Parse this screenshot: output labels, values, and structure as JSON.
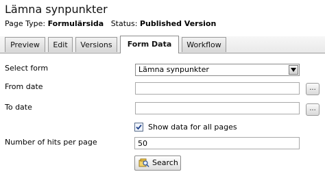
{
  "header": {
    "title": "Lämna synpunkter",
    "page_type_label": "Page Type:",
    "page_type_value": "Formulärsida",
    "status_label": "Status:",
    "status_value": "Published Version"
  },
  "tabs": [
    {
      "label": "Preview",
      "active": false
    },
    {
      "label": "Edit",
      "active": false
    },
    {
      "label": "Versions",
      "active": false
    },
    {
      "label": "Form Data",
      "active": true
    },
    {
      "label": "Workflow",
      "active": false
    }
  ],
  "form": {
    "select_form_label": "Select form",
    "select_form_value": "Lämna synpunkter",
    "from_date_label": "From date",
    "from_date_value": "",
    "to_date_label": "To date",
    "to_date_value": "",
    "browse_label": "...",
    "show_all_label": "Show data for all pages",
    "show_all_checked": true,
    "hits_label": "Number of hits per page",
    "hits_value": "50",
    "search_label": "Search"
  }
}
